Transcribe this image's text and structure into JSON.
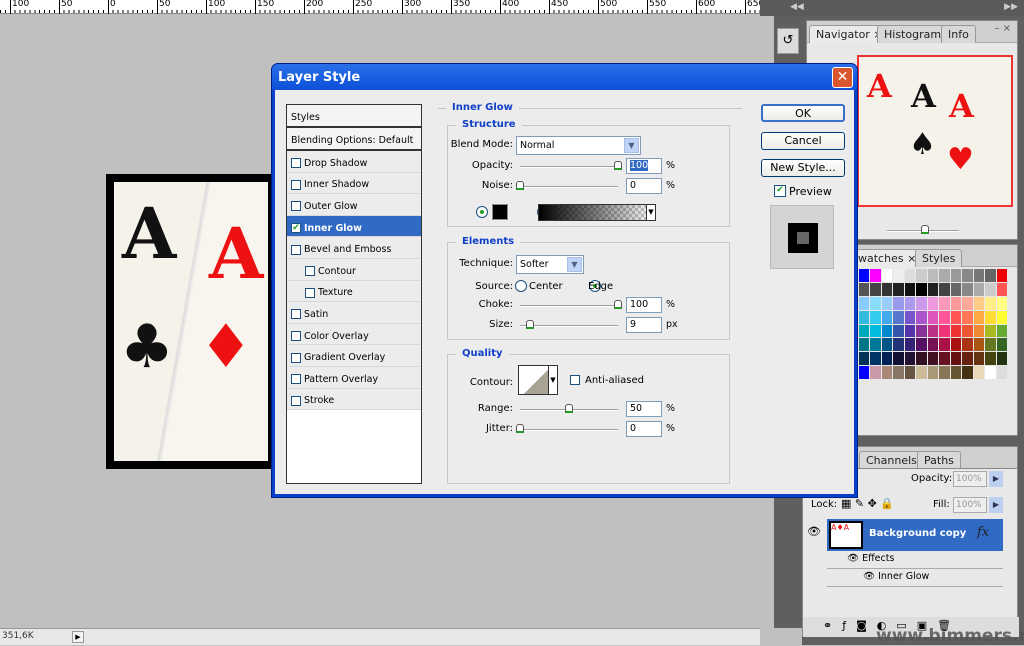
{
  "ruler": {
    "labels": [
      "100",
      "50",
      "0",
      "50",
      "100",
      "150",
      "200",
      "250",
      "300",
      "350",
      "400",
      "450",
      "500",
      "550",
      "600",
      "650"
    ]
  },
  "status": {
    "zoom_value": "351,6K"
  },
  "dialog": {
    "title": "Layer Style",
    "styles_header": "Styles",
    "blending": "Blending Options: Default",
    "style_items": [
      {
        "label": "Drop Shadow",
        "checked": false
      },
      {
        "label": "Inner Shadow",
        "checked": false
      },
      {
        "label": "Outer Glow",
        "checked": false
      },
      {
        "label": "Inner Glow",
        "checked": true
      },
      {
        "label": "Bevel and Emboss",
        "checked": false
      },
      {
        "label": "Contour",
        "checked": false
      },
      {
        "label": "Texture",
        "checked": false
      },
      {
        "label": "Satin",
        "checked": false
      },
      {
        "label": "Color Overlay",
        "checked": false
      },
      {
        "label": "Gradient Overlay",
        "checked": false
      },
      {
        "label": "Pattern Overlay",
        "checked": false
      },
      {
        "label": "Stroke",
        "checked": false
      }
    ],
    "section_title": "Inner Glow",
    "structure": {
      "title": "Structure",
      "blend_mode_label": "Blend Mode:",
      "blend_mode": "Normal",
      "opacity_label": "Opacity:",
      "opacity": "100",
      "noise_label": "Noise:",
      "noise": "0",
      "unit": "%",
      "glow_color": "#000000"
    },
    "elements": {
      "title": "Elements",
      "technique_label": "Technique:",
      "technique": "Softer",
      "source_label": "Source:",
      "source_center": "Center",
      "source_edge": "Edge",
      "source_selected": "Edge",
      "choke_label": "Choke:",
      "choke": "100",
      "size_label": "Size:",
      "size": "9",
      "size_unit": "px",
      "pct": "%"
    },
    "quality": {
      "title": "Quality",
      "contour_label": "Contour:",
      "anti_aliased": "Anti-aliased",
      "anti_aliased_checked": false,
      "range_label": "Range:",
      "range": "50",
      "jitter_label": "Jitter:",
      "jitter": "0",
      "pct": "%"
    },
    "buttons": {
      "ok": "OK",
      "cancel": "Cancel",
      "new_style": "New Style...",
      "preview": "Preview",
      "preview_checked": true
    }
  },
  "navigator": {
    "tabs": [
      "Navigator",
      "Histogram",
      "Info"
    ]
  },
  "swatches": {
    "tabs": [
      "Swatches",
      "Styles"
    ],
    "visible_tab_text": "watches"
  },
  "layers": {
    "tabs": [
      "Channels",
      "Paths"
    ],
    "opacity_label": "Opacity:",
    "opacity": "100%",
    "lock_label": "Lock:",
    "fill_label": "Fill:",
    "fill": "100%",
    "layer_name": "Background copy",
    "effects": "Effects",
    "effect_item": "Inner Glow",
    "fx": "fx"
  },
  "watermark": "www.bimmers.no",
  "colors": {
    "accent": "#316ac5",
    "titlebar": "#0b50d8",
    "section": "#1040c8",
    "check": "#21a121"
  }
}
